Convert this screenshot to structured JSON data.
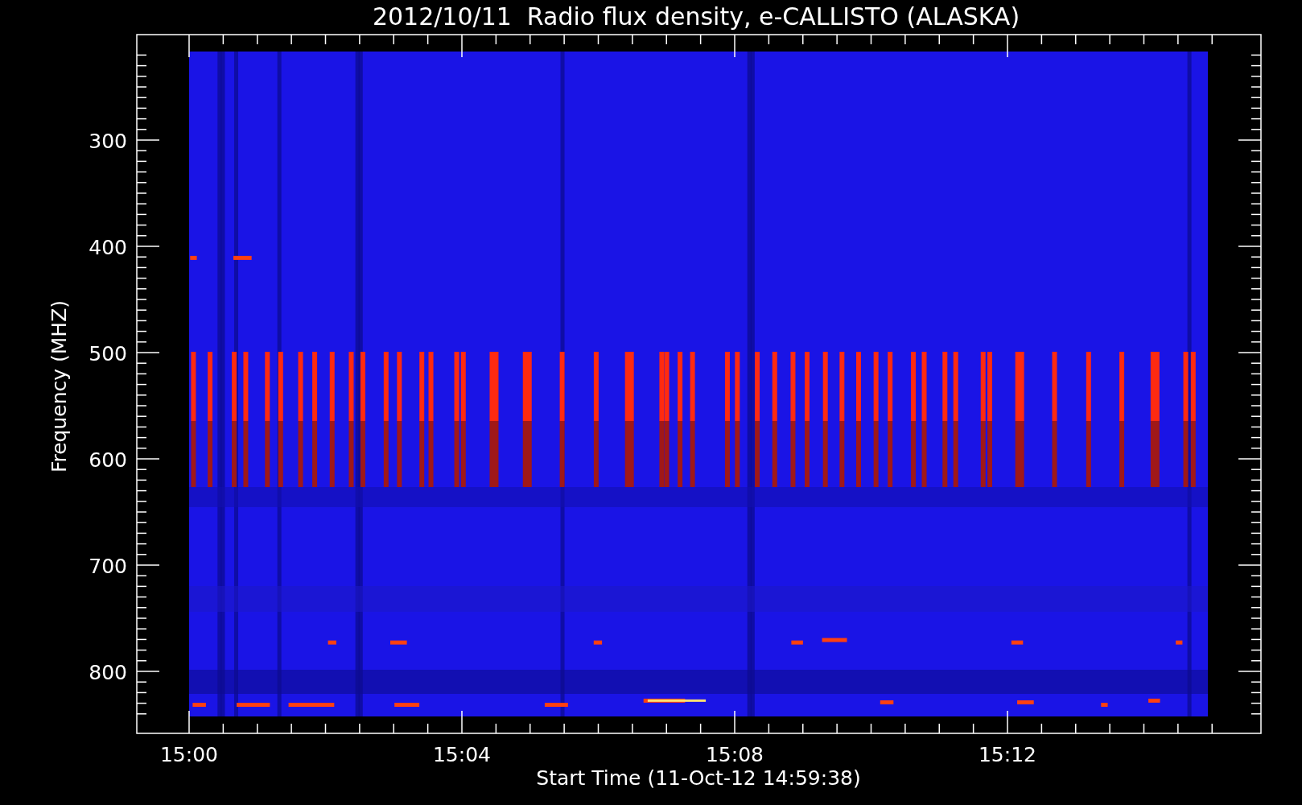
{
  "title": "2012/10/11  Radio flux density, e-CALLISTO (ALASKA)",
  "y_axis": {
    "label": "Frequency (MHZ)",
    "ticks": [
      "300",
      "400",
      "500",
      "600",
      "700",
      "800"
    ]
  },
  "x_axis": {
    "label": "Start Time (11-Oct-12 14:59:38)",
    "ticks": [
      "15:00",
      "15:04",
      "15:08",
      "15:12"
    ]
  }
}
